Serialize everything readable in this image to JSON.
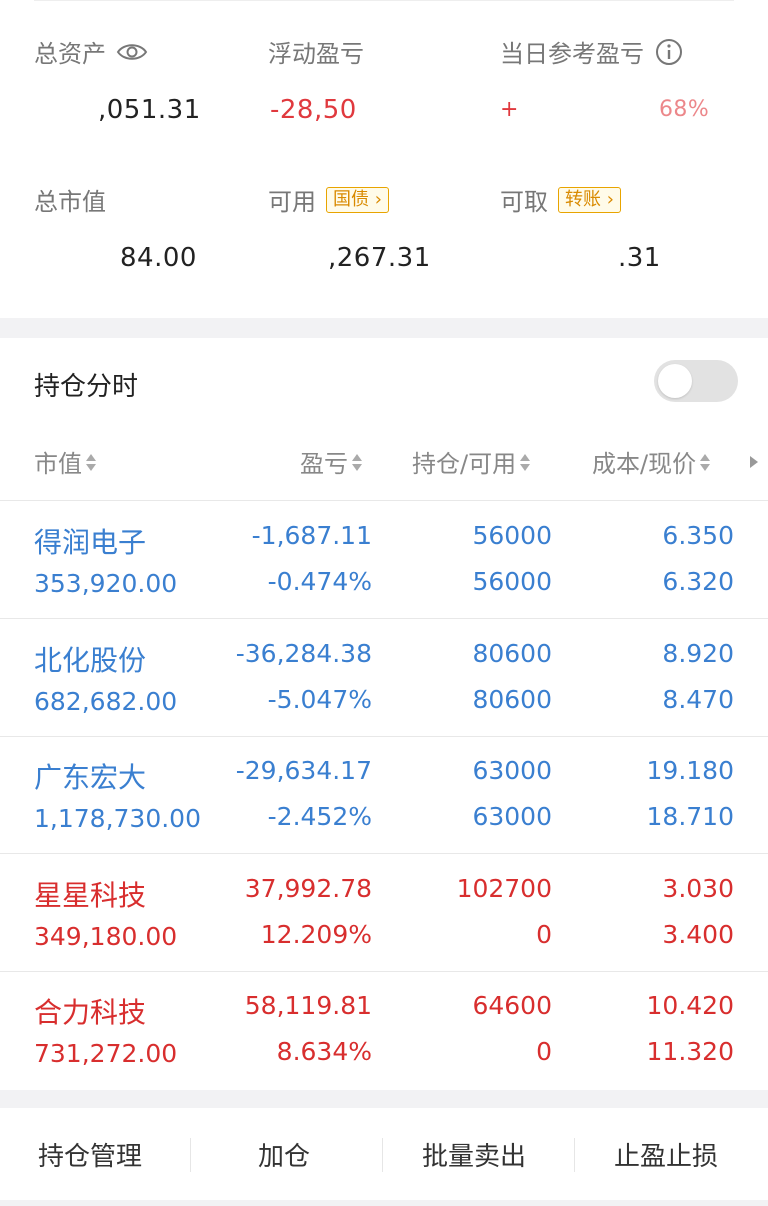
{
  "summary": {
    "total_assets_label": "总资产",
    "total_assets_value": ",051.31",
    "floating_pnl_label": "浮动盈亏",
    "floating_pnl_value": "-28,50",
    "daily_pnl_label": "当日参考盈亏",
    "daily_pnl_value_a": "+",
    "daily_pnl_value_b": "68%",
    "market_value_label": "总市值",
    "market_value_value": "84.00",
    "available_label": "可用",
    "available_tag": "国债",
    "available_value": ",267.31",
    "withdrawable_label": "可取",
    "withdrawable_tag": "转账",
    "withdrawable_value": ".31"
  },
  "holdings": {
    "title": "持仓分时",
    "toggle_on": false,
    "columns": {
      "market_value": "市值",
      "pnl": "盈亏",
      "position": "持仓/可用",
      "cost_price": "成本/现价"
    },
    "rows": [
      {
        "name": "得润电子",
        "market_value": "353,920.00",
        "pnl": "-1,687.11",
        "pnl_pct": "-0.474%",
        "position": "56000",
        "available": "56000",
        "cost": "6.350",
        "price": "6.320",
        "tone": "blue"
      },
      {
        "name": "北化股份",
        "market_value": "682,682.00",
        "pnl": "-36,284.38",
        "pnl_pct": "-5.047%",
        "position": "80600",
        "available": "80600",
        "cost": "8.920",
        "price": "8.470",
        "tone": "blue"
      },
      {
        "name": "广东宏大",
        "market_value": "1,178,730.00",
        "pnl": "-29,634.17",
        "pnl_pct": "-2.452%",
        "position": "63000",
        "available": "63000",
        "cost": "19.180",
        "price": "18.710",
        "tone": "blue"
      },
      {
        "name": "星星科技",
        "market_value": "349,180.00",
        "pnl": "37,992.78",
        "pnl_pct": "12.209%",
        "position": "102700",
        "available": "0",
        "cost": "3.030",
        "price": "3.400",
        "tone": "red"
      },
      {
        "name": "合力科技",
        "market_value": "731,272.00",
        "pnl": "58,119.81",
        "pnl_pct": "8.634%",
        "position": "64600",
        "available": "0",
        "cost": "10.420",
        "price": "11.320",
        "tone": "red"
      }
    ]
  },
  "actions": {
    "manage": "持仓管理",
    "add": "加仓",
    "batch_sell": "批量卖出",
    "stop": "止盈止损"
  },
  "colors": {
    "loss_blue": "#3a7fd0",
    "gain_red": "#d82e2e",
    "tag_orange": "#e8a400"
  }
}
